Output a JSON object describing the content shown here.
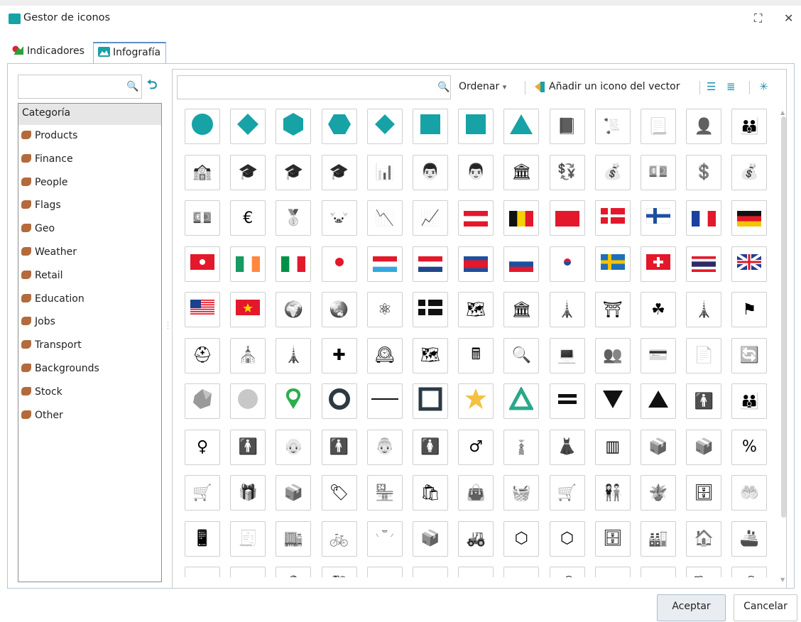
{
  "window": {
    "title": "Gestor de iconos",
    "maximize_glyph": "⛶",
    "close_glyph": "✕"
  },
  "tabs": [
    {
      "label": "Indicadores",
      "icon": "indicators-icon",
      "active": false
    },
    {
      "label": "Infografía",
      "icon": "image-icon",
      "active": true
    }
  ],
  "left_panel": {
    "search_value": "",
    "search_glyph": "🔍",
    "undo_glyph": "⮌",
    "category_header": "Categoría",
    "categories": [
      "Products",
      "Finance",
      "People",
      "Flags",
      "Geo",
      "Weather",
      "Retail",
      "Education",
      "Jobs",
      "Transport",
      "Backgrounds",
      "Stock",
      "Other"
    ]
  },
  "toolbar": {
    "search_value": "",
    "search_glyph": "🔍",
    "sort_label": "Ordenar",
    "sort_caret": "▾",
    "add_label": "Añadir un icono del vector",
    "view_list_glyph": "☰",
    "view_detail_glyph": "≣",
    "expand_glyph": "✳"
  },
  "colors": {
    "accent_teal": "#17a2a6",
    "flag_red": "#e3182b",
    "ui_blue": "#1a8fa8"
  },
  "icon_rows": [
    [
      "circle-icon",
      "diamond-icon",
      "octagon-icon",
      "hexagon-icon",
      "diamond-small-icon",
      "square-icon",
      "square-alt-icon",
      "triangle-icon",
      "book-icon",
      "certificate-icon",
      "scroll-icon",
      "podium-person-icon",
      "parent-child-icon"
    ],
    [
      "school-icon",
      "graduate-male-icon",
      "graduate-female-icon",
      "mortarboard-icon",
      "class-board-icon",
      "teacher-class-icon",
      "teacher-board-icon",
      "bank-icon",
      "currency-exchange-icon",
      "money-bag-dollar-icon",
      "cash-stack-icon",
      "coins-dollar-icon",
      "money-bag-euro-icon"
    ],
    [
      "banknotes-euro-icon",
      "coins-euro-icon",
      "gold-bars-icon",
      "piggy-bank-icon",
      "stock-down-icon",
      "stock-up-icon",
      "flag-austria-icon",
      "flag-belgium-icon",
      "flag-china-icon",
      "flag-denmark-icon",
      "flag-finland-icon",
      "flag-france-icon",
      "flag-germany-icon"
    ],
    [
      "flag-hong-kong-icon",
      "flag-ireland-icon",
      "flag-italy-icon",
      "flag-japan-icon",
      "flag-luxembourg-icon",
      "flag-netherlands-icon",
      "flag-north-korea-icon",
      "flag-russia-icon",
      "flag-south-korea-icon",
      "flag-sweden-icon",
      "flag-switzerland-icon",
      "flag-thailand-icon",
      "flag-uk-icon"
    ],
    [
      "flag-usa-icon",
      "flag-vietnam-icon",
      "africa-map-icon",
      "asia-map-icon",
      "atomium-icon",
      "flag-nordic-icon",
      "europe-map-icon",
      "capitol-icon",
      "eiffel-tower-icon",
      "brandenburg-gate-icon",
      "clover-icon",
      "pisa-tower-icon",
      "windmill-icon"
    ],
    [
      "viking-helmet-icon",
      "sagrada-familia-icon",
      "space-needle-icon",
      "swiss-cross-icon",
      "big-ben-icon",
      "usa-map-icon",
      "calculator-icon",
      "job-search-icon",
      "code-monitor-icon",
      "crowd-icon",
      "web-payment-icon",
      "resume-icon",
      "exchange-people-icon"
    ],
    [
      "polygon-background-icon",
      "grey-circle-icon",
      "location-pin-icon",
      "ring-icon",
      "line-icon",
      "square-frame-icon",
      "star-badge-icon",
      "triangle-outline-icon",
      "equals-icon",
      "triangle-down-icon",
      "triangle-up-icon",
      "person-small-icon",
      "family-icon"
    ],
    [
      "female-symbol-icon",
      "person-icon",
      "elderly-man-icon",
      "man-icon",
      "elderly-woman-icon",
      "woman-icon",
      "male-symbol-icon",
      "businessman-icon",
      "businesswoman-icon",
      "barcode-icon",
      "box-icon",
      "open-box-icon",
      "discount-badge-icon"
    ],
    [
      "shopping-trolley-icon",
      "gift-icon",
      "package-icon",
      "price-tag-icon",
      "shop-front-icon",
      "shopping-bag-icon",
      "bag-outline-icon",
      "basket-icon",
      "shopping-cart-icon",
      "couple-shopping-icon",
      "box-plants-icon",
      "drawer-cabinet-icon",
      "hands-gift-icon"
    ],
    [
      "smartphone-icon",
      "cashier-icon",
      "store-icon",
      "bicycle-icon",
      "tshirt-hanger-icon",
      "parcel-icon",
      "forklift-icon",
      "box-3d-icon",
      "box-3d-alt-icon",
      "warehouse-shelf-icon",
      "warehouse-icon",
      "house-shield-icon",
      "cargo-ship-icon"
    ],
    [
      "monitor-icon",
      "bird-icon",
      "pin-icon",
      "backpack-icon",
      "line-flat-icon",
      "sun-icon",
      "cloud-icon",
      "cloud-alt-icon",
      "cloud-rain-icon",
      "cloud-big-icon",
      "cloud-sun-icon",
      "cloud-wind-icon",
      "rain-icon"
    ]
  ]
}
